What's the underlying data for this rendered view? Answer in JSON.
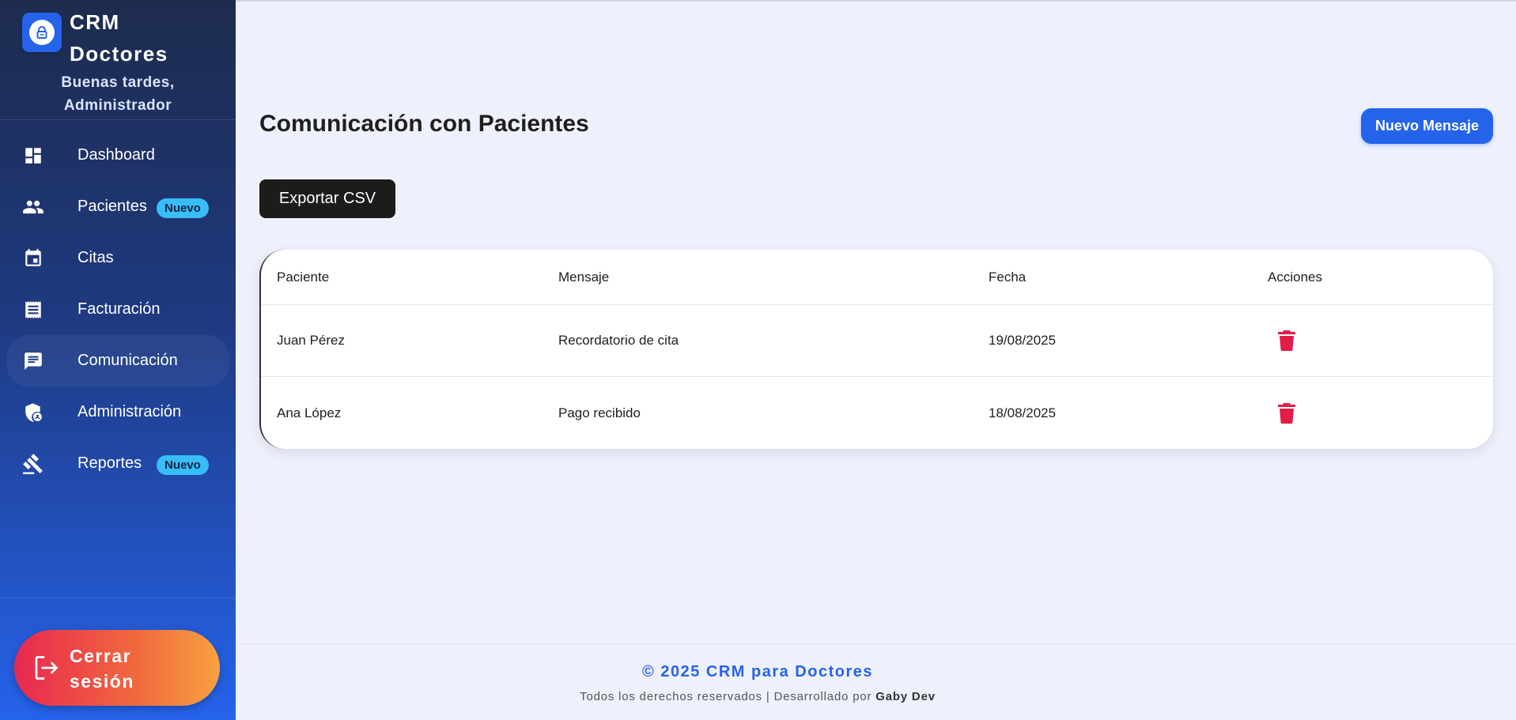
{
  "sidebar": {
    "brand_title": "CRM Doctores",
    "greeting": "Buenas tardes, Administrador",
    "items": [
      {
        "label": "Dashboard",
        "icon": "dashboard-icon"
      },
      {
        "label": "Pacientes",
        "icon": "people-icon",
        "badge": "Nuevo"
      },
      {
        "label": "Citas",
        "icon": "calendar-icon"
      },
      {
        "label": "Facturación",
        "icon": "receipt-icon"
      },
      {
        "label": "Comunicación",
        "icon": "chat-icon",
        "active": true
      },
      {
        "label": "Administración",
        "icon": "admin-shield-icon"
      },
      {
        "label": "Reportes",
        "icon": "gavel-icon",
        "badge": "Nuevo"
      }
    ],
    "logout_label": "Cerrar sesión"
  },
  "main": {
    "title": "Comunicación con Pacientes",
    "new_message_label": "Nuevo Mensaje",
    "export_label": "Exportar CSV",
    "table": {
      "headers": [
        "Paciente",
        "Mensaje",
        "Fecha",
        "Acciones"
      ],
      "rows": [
        {
          "patient": "Juan Pérez",
          "message": "Recordatorio de cita",
          "date": "19/08/2025",
          "action": "delete-icon"
        },
        {
          "patient": "Ana López",
          "message": "Pago recibido",
          "date": "18/08/2025",
          "action": "delete-icon"
        }
      ]
    }
  },
  "footer": {
    "copyright": "© 2025 CRM para Doctores",
    "rights_prefix": "Todos los derechos reservados | Desarrollado por ",
    "developer": "Gaby Dev"
  },
  "colors": {
    "accent": "#2563eb",
    "badge": "#38bdf8",
    "delete": "#e11d48",
    "logout_start": "#e8284f",
    "logout_end": "#f7a13f"
  }
}
